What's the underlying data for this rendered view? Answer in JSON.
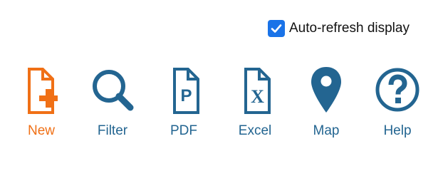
{
  "autorefresh": {
    "label": "Auto-refresh display",
    "checked": true,
    "checkbox_color": "#1a73e8"
  },
  "toolbar": {
    "items": [
      {
        "label": "New",
        "icon": "new-file-icon",
        "color": "#f07016"
      },
      {
        "label": "Filter",
        "icon": "magnifier-icon",
        "color": "#236591"
      },
      {
        "label": "PDF",
        "icon": "pdf-file-icon",
        "color": "#236591"
      },
      {
        "label": "Excel",
        "icon": "excel-file-icon",
        "color": "#236591"
      },
      {
        "label": "Map",
        "icon": "map-pin-icon",
        "color": "#236591"
      },
      {
        "label": "Help",
        "icon": "help-circle-icon",
        "color": "#236591"
      }
    ]
  }
}
